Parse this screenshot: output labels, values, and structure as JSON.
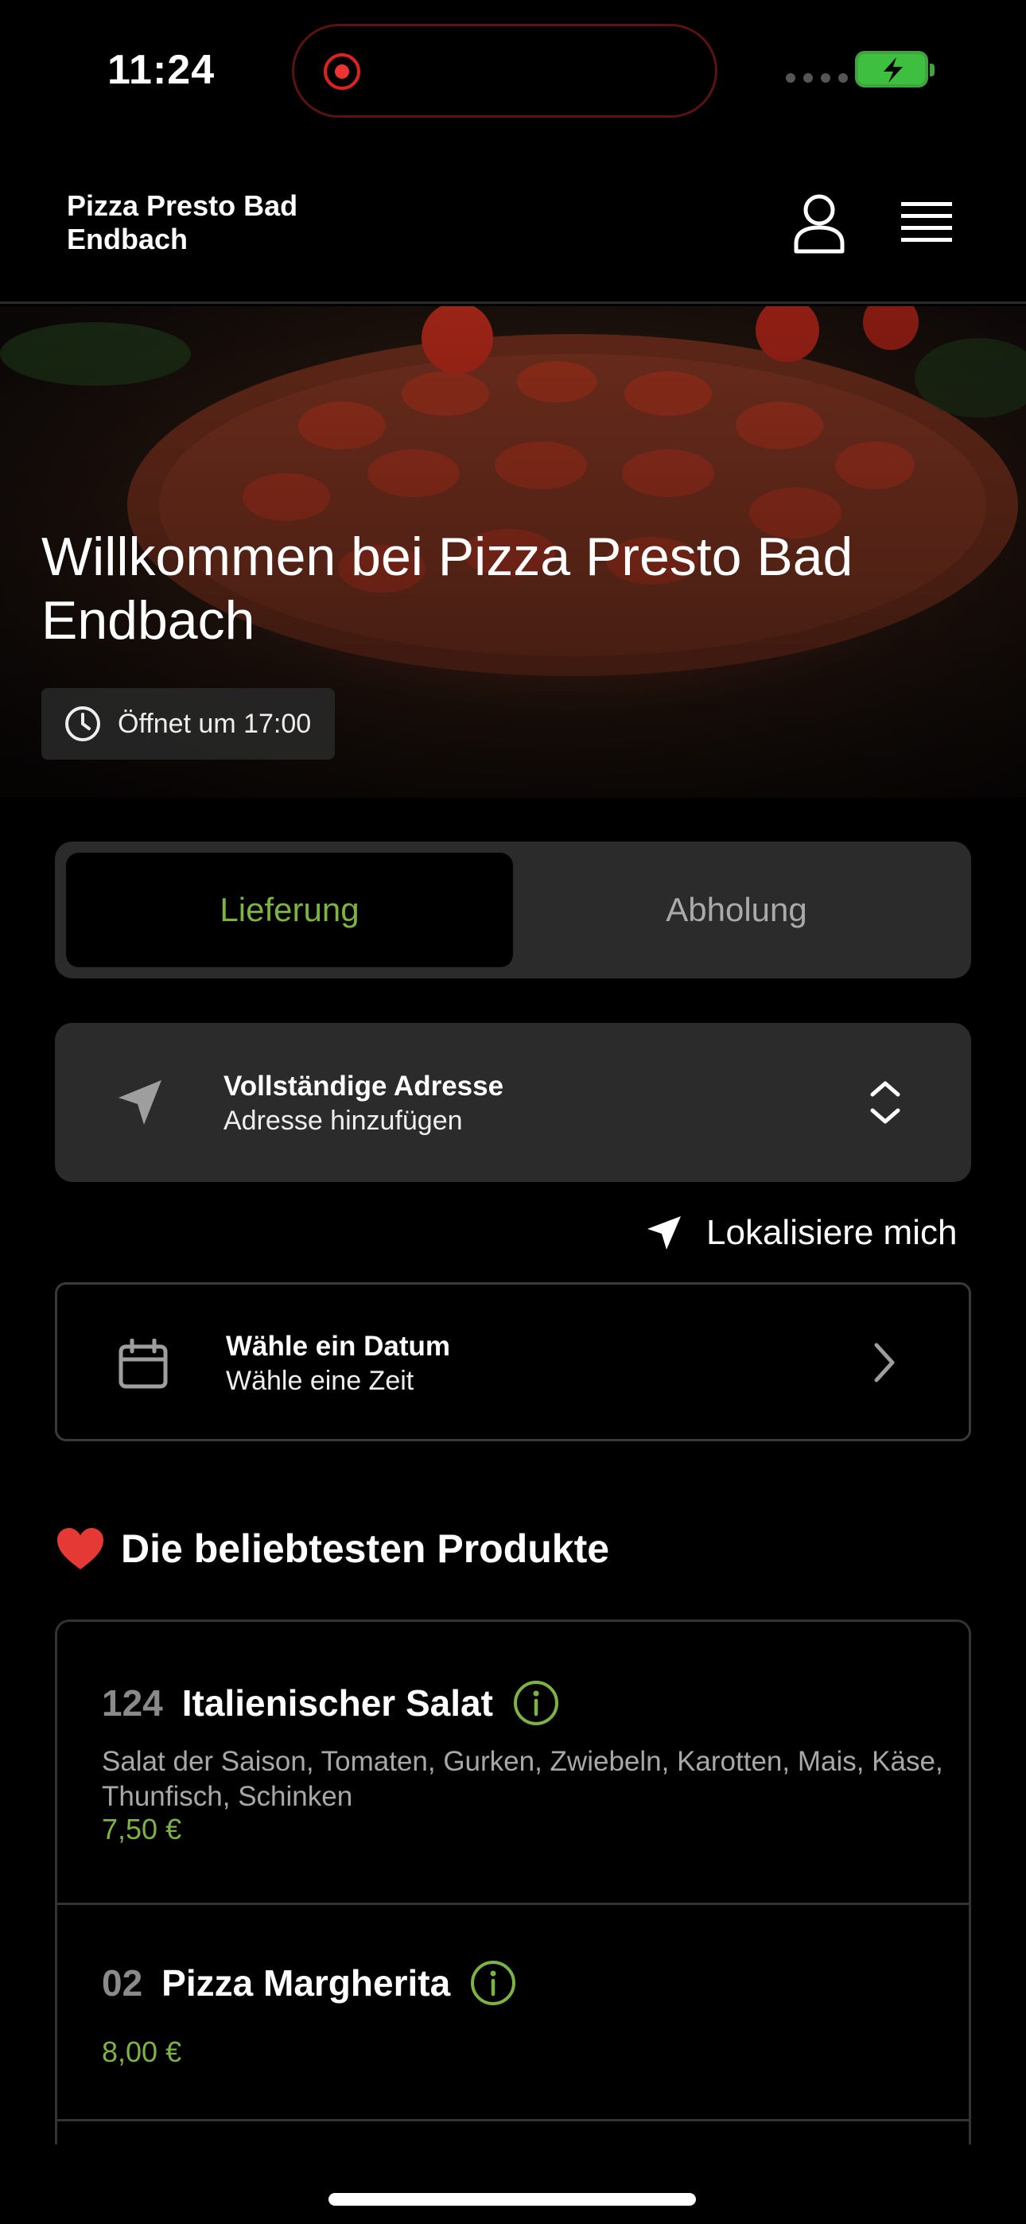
{
  "status_bar": {
    "time": "11:24"
  },
  "header": {
    "title": "Pizza Presto Bad Endbach"
  },
  "hero": {
    "title": "Willkommen bei Pizza Presto Bad Endbach",
    "hours": "Öffnet um 17:00"
  },
  "order_mode": {
    "options": [
      "Lieferung",
      "Abholung"
    ],
    "selected": "Lieferung"
  },
  "address": {
    "title": "Vollständige Adresse",
    "subtitle": "Adresse hinzufügen"
  },
  "locate_me": {
    "label": "Lokalisiere mich"
  },
  "schedule": {
    "title": "Wähle ein Datum",
    "subtitle": "Wähle eine Zeit"
  },
  "popular": {
    "title": "Die beliebtesten Produkte",
    "products": [
      {
        "number": "124",
        "name": "Italienischer Salat",
        "description": "Salat der Saison, Tomaten, Gurken, Zwiebeln, Karotten, Mais, Käse, Thunfisch, Schinken",
        "price": "7,50 €"
      },
      {
        "number": "02",
        "name": "Pizza Margherita",
        "description": "",
        "price": "8,00 €"
      }
    ]
  },
  "colors": {
    "accent": "#7cb342",
    "card_bg": "#2b2b2b",
    "background": "#000000"
  },
  "icons": [
    "user-icon",
    "menu-icon",
    "clock-icon",
    "navigation-arrow-icon",
    "chevron-up-down-icon",
    "calendar-icon",
    "chevron-right-icon",
    "heart-icon",
    "info-icon"
  ]
}
